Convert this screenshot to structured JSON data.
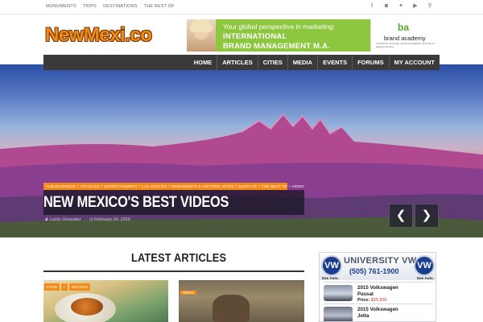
{
  "topnav": {
    "items": [
      "MONUMENTS",
      "TRIPS",
      "DESTINATIONS",
      "THE BEST OF"
    ]
  },
  "social": {
    "icons": [
      "facebook-icon",
      "instagram-icon",
      "twitter-icon",
      "youtube-icon",
      "search-icon"
    ],
    "glyphs": [
      "f",
      "◙",
      "✦",
      "▶",
      "⚲"
    ]
  },
  "logo": {
    "text": "NewMexi.co"
  },
  "ad": {
    "line1": "Your global perspective in marketing:",
    "line2": "INTERNATIONAL",
    "line3": "BRAND MANAGEMENT M.A.",
    "brand_mark": "ba",
    "brand_name": "brand academy",
    "brand_sub": "hochschule für design und kommunikation university of applied sciences",
    "color": "#8dc63f"
  },
  "mainnav": {
    "items": [
      "HOME",
      "ARTICLES",
      "CITIES",
      "MEDIA",
      "EVENTS",
      "FORUMS",
      "MY ACCOUNT"
    ]
  },
  "hero": {
    "crumbs": [
      "ALBUQUERQUE",
      "/",
      "ARTICLES",
      "/",
      "ENTERTAINMENT",
      "/",
      "LAS CRUCES",
      "/",
      "MONUMENTS & HISTORIC SITES",
      "/",
      "SANTA FE",
      "/",
      "THE BEST OF",
      "/",
      "VIDEO"
    ],
    "title": "NEW MEXICO'S BEST VIDEOS",
    "author": "Lucky Gonzalez",
    "date": "February 24, 2016",
    "prev": "❮",
    "next": "❯"
  },
  "latest": {
    "heading": "LATEST ARTICLES",
    "cards": [
      {
        "tags": [
          "FOOD",
          "/",
          "RECIPES"
        ]
      },
      {
        "tags": [
          "NEWS"
        ]
      }
    ]
  },
  "side_ad": {
    "name": "UNIVERSITY VW",
    "phone": "(505) 761-1900",
    "left_mark": "VW",
    "right_mark": "VW",
    "das_auto_left": "Das Auto.",
    "das_auto_right": "Das Auto.",
    "cars": [
      {
        "title_line1": "2015 Volkswagen",
        "title_line2": "Passat",
        "price_label": "Price:",
        "price": "$25,830"
      },
      {
        "title_line1": "2015 Volkswagen",
        "title_line2": "Jetta",
        "price_label": "",
        "price": ""
      }
    ]
  },
  "colors": {
    "accent": "#f48a19",
    "nav_bg": "#3a3a3a",
    "vw_blue": "#1b3d8f"
  }
}
